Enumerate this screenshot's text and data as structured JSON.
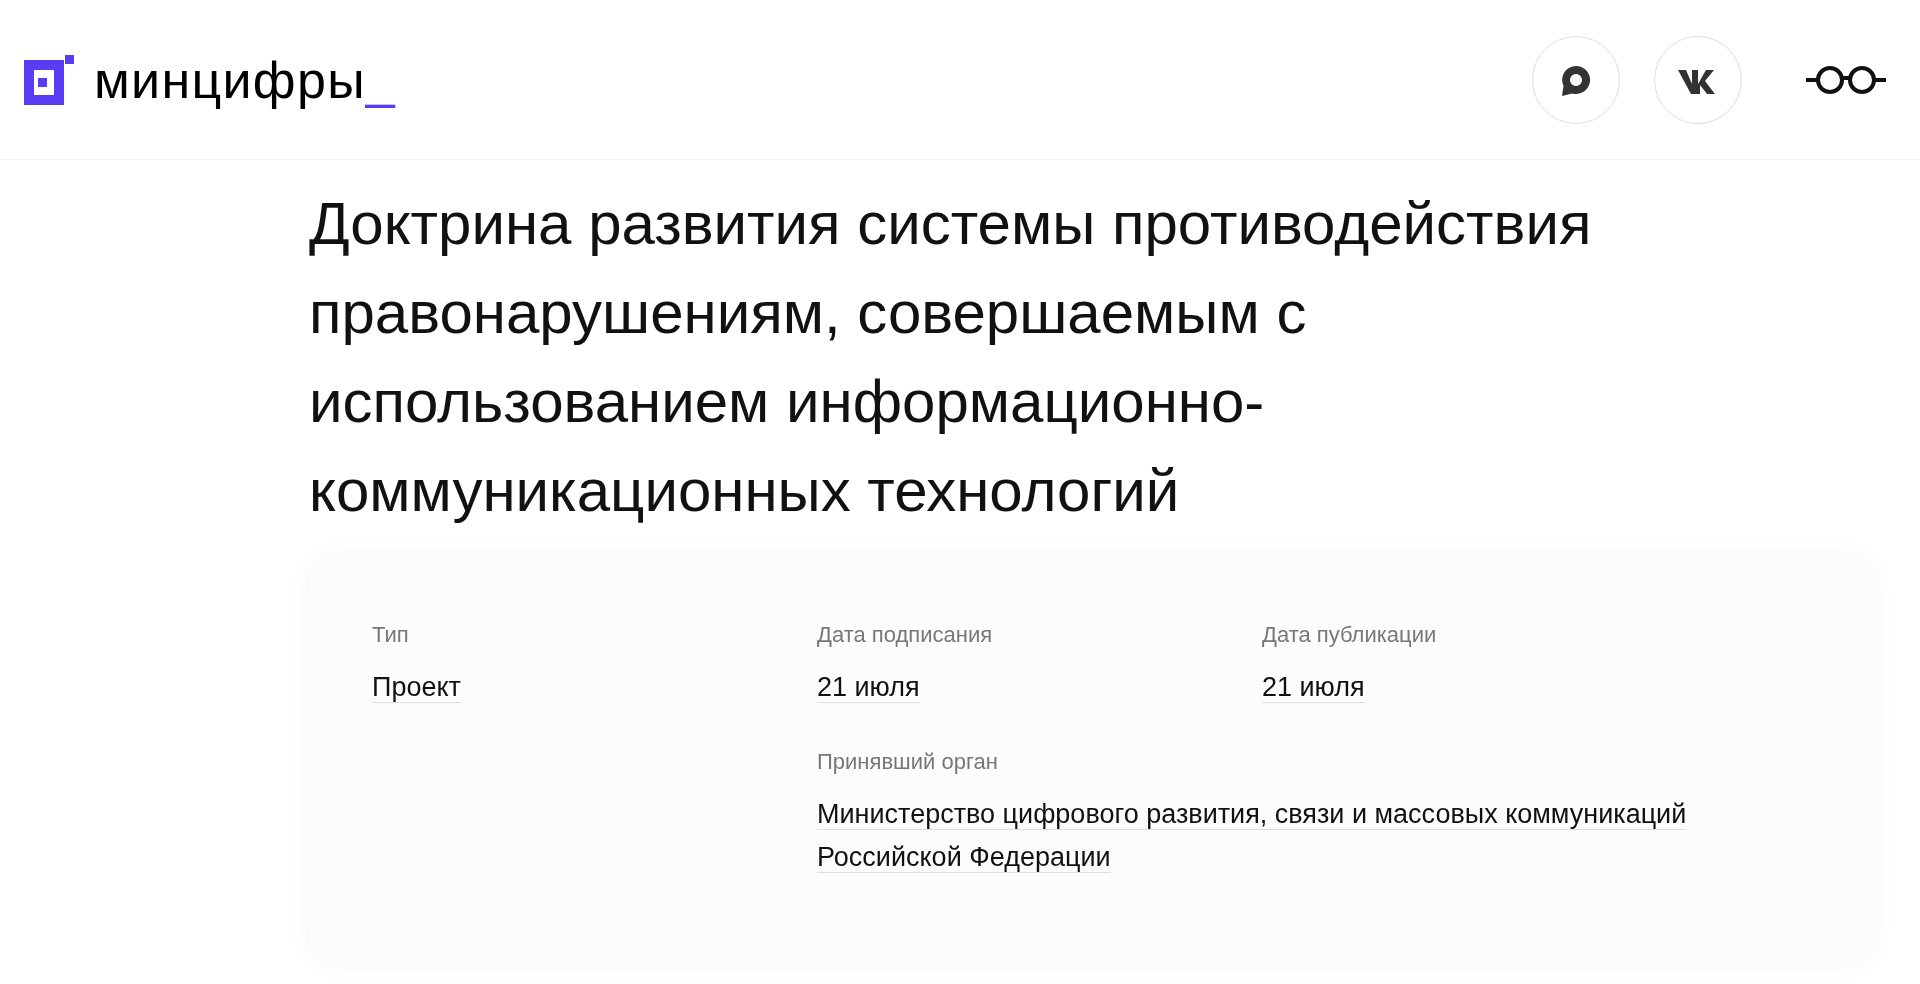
{
  "header": {
    "logo": "минцифры",
    "logo_cursor": "_"
  },
  "title": "Доктрина развития системы противодействия правонарушениям, совершаемым с использованием информационно-коммуникационных технологий",
  "details": [
    {
      "label": "Тип",
      "value": "Проект"
    },
    {
      "label": "Дата подписания",
      "value": "21 июля"
    },
    {
      "label": "Дата публикации",
      "value": "21 июля"
    },
    {
      "label": "Принявший орган",
      "value": "Министерство цифрового развития, связи и массовых коммуникаций Российской Федерации"
    }
  ]
}
